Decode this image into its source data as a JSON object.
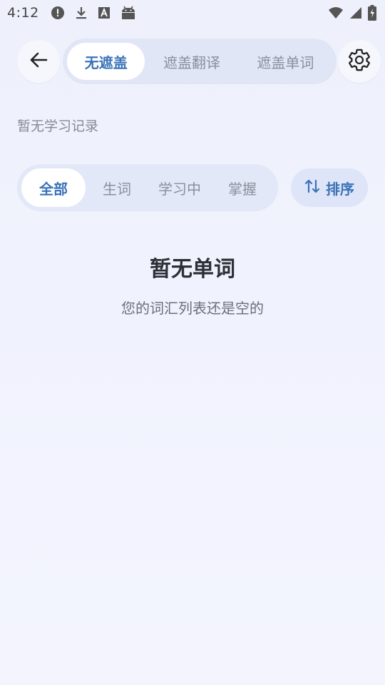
{
  "status_bar": {
    "time": "4:12",
    "icons_left": [
      "alert-icon",
      "download-icon",
      "font-a-icon",
      "android-icon"
    ],
    "icons_right": [
      "wifi-icon",
      "signal-icon",
      "battery-charging-icon"
    ]
  },
  "top_bar": {
    "back_icon": "arrow-left-icon",
    "settings_icon": "gear-icon",
    "mode_tabs": [
      {
        "label": "无遮盖",
        "selected": true
      },
      {
        "label": "遮盖翻译",
        "selected": false
      },
      {
        "label": "遮盖单词",
        "selected": false
      }
    ]
  },
  "record": {
    "text": "暂无学习记录"
  },
  "filter": {
    "tabs": [
      {
        "label": "全部",
        "selected": true
      },
      {
        "label": "生词",
        "selected": false
      },
      {
        "label": "学习中",
        "selected": false
      },
      {
        "label": "掌握",
        "selected": false
      }
    ],
    "sort_label": "排序",
    "sort_icon": "sort-arrows-icon"
  },
  "empty_state": {
    "title": "暂无单词",
    "subtitle": "您的词汇列表还是空的"
  },
  "colors": {
    "accent": "#3a73b8",
    "background": "#eef0fb",
    "tab_track": "#e1e6f7"
  }
}
